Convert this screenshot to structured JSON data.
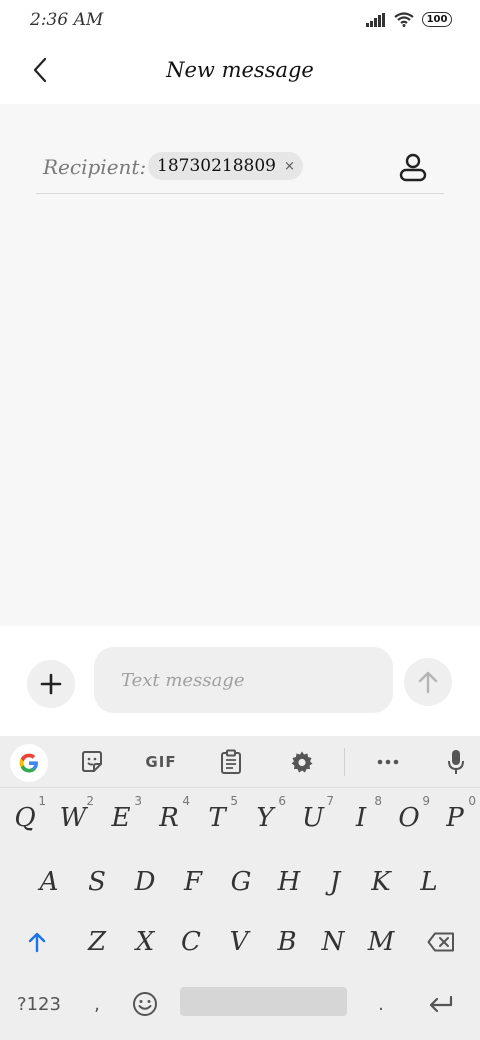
{
  "status_bar": {
    "time": "2:36 AM",
    "battery": "100",
    "icons": [
      "signal-icon",
      "wifi-icon",
      "battery-icon"
    ]
  },
  "header": {
    "title": "New message",
    "back_icon": "back-arrow-icon"
  },
  "recipient": {
    "label": "Recipient:",
    "chip_value": "18730218809",
    "chip_remove": "×",
    "contact_icon": "contact-icon"
  },
  "compose": {
    "placeholder": "Text message",
    "add_icon": "plus-icon",
    "send_icon": "send-arrow-icon"
  },
  "keyboard": {
    "toolbar": {
      "google": "G",
      "sticker_icon": "sticker-icon",
      "gif": "GIF",
      "clipboard_icon": "clipboard-icon",
      "settings_icon": "gear-icon",
      "more_icon": "more-icon",
      "mic_icon": "mic-icon"
    },
    "row1": [
      {
        "key": "Q",
        "hint": "1"
      },
      {
        "key": "W",
        "hint": "2"
      },
      {
        "key": "E",
        "hint": "3"
      },
      {
        "key": "R",
        "hint": "4"
      },
      {
        "key": "T",
        "hint": "5"
      },
      {
        "key": "Y",
        "hint": "6"
      },
      {
        "key": "U",
        "hint": "7"
      },
      {
        "key": "I",
        "hint": "8"
      },
      {
        "key": "O",
        "hint": "9"
      },
      {
        "key": "P",
        "hint": "0"
      }
    ],
    "row2": [
      "A",
      "S",
      "D",
      "F",
      "G",
      "H",
      "J",
      "K",
      "L"
    ],
    "row3": [
      "Z",
      "X",
      "C",
      "V",
      "B",
      "N",
      "M"
    ],
    "bottom": {
      "symbols": "?123",
      "comma": ",",
      "period": "."
    }
  },
  "colors": {
    "background": "#f7f7f7",
    "keyboard": "#eeeeee",
    "shift_blue": "#1a73e8",
    "google_blue": "#4285F4",
    "google_red": "#EA4335",
    "google_yellow": "#FBBC05",
    "google_green": "#34A853"
  }
}
